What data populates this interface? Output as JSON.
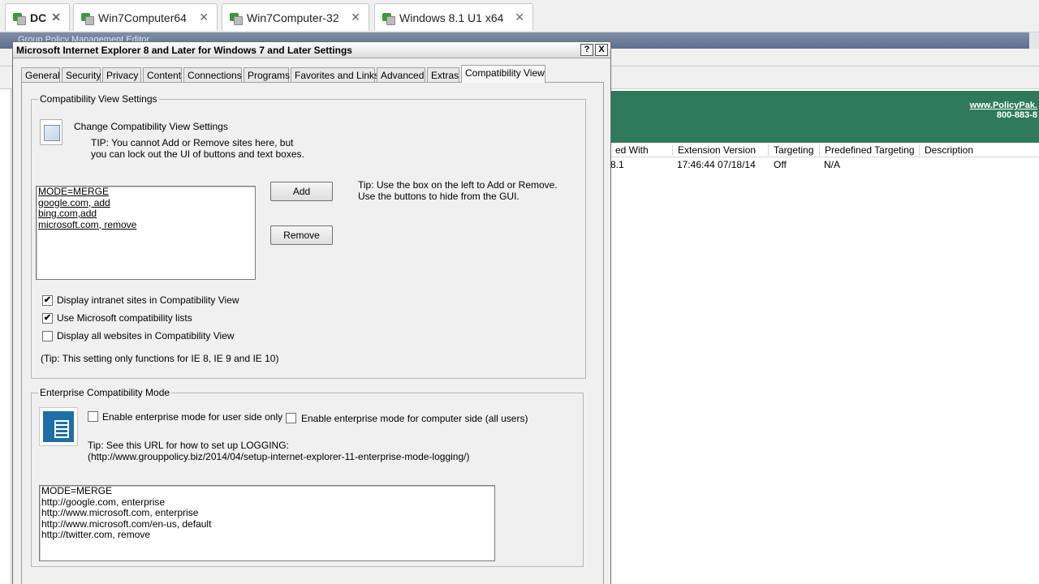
{
  "vm_tabs": [
    {
      "label": "DC",
      "active": true
    },
    {
      "label": "Win7Computer64",
      "active": false
    },
    {
      "label": "Win7Computer-32",
      "active": false
    },
    {
      "label": "Windows 8.1 U1 x64",
      "active": false
    }
  ],
  "bg_window": {
    "title": "Group Policy Management Editor",
    "banner_url": "www.PolicyPak.",
    "banner_phone": "800-883-8",
    "columns": [
      "ed With",
      "Extension Version",
      "Targeting",
      "Predefined Targeting",
      "Description"
    ],
    "row": [
      "8.1",
      "17:46:44 07/18/14",
      "Off",
      "N/A",
      ""
    ]
  },
  "dialog": {
    "title": "Microsoft Internet Explorer 8 and Later for Windows 7 and Later Settings",
    "help_btn": "?",
    "close_btn": "X",
    "tabs": [
      "General",
      "Security",
      "Privacy",
      "Content",
      "Connections",
      "Programs",
      "Favorites and Links",
      "Advanced",
      "Extras",
      "Compatibility View"
    ],
    "active_tab": "Compatibility View"
  },
  "compat": {
    "group_title": "Compatibility View Settings",
    "heading": "Change Compatibility View Settings",
    "tip1": "TIP: You cannot Add or Remove sites here, but",
    "tip2": "you can lock out the UI of buttons and text boxes.",
    "list": [
      "MODE=MERGE",
      "google.com, add",
      "bing.com,add",
      "microsoft.com, remove"
    ],
    "add_label": "Add",
    "remove_label": "Remove",
    "side_tip1": "Tip: Use the box on the left to Add or Remove.",
    "side_tip2": "Use the buttons to hide from the GUI.",
    "checkboxes": [
      {
        "label": "Display intranet sites in Compatibility View",
        "checked": "✔"
      },
      {
        "label": "Use Microsoft compatibility lists",
        "checked": "✔"
      },
      {
        "label": "Display all websites in Compatibility View",
        "checked": ""
      }
    ],
    "footnote": "(Tip: This setting only functions for IE 8, IE 9 and IE 10)"
  },
  "enterprise": {
    "group_title": "Enterprise Compatibility Mode",
    "user_label": "Enable enterprise mode for user side only",
    "computer_label": "Enable enterprise mode for computer side (all users)",
    "tip1": "Tip: See this URL for how to set up LOGGING:",
    "tip2": "(http://www.grouppolicy.biz/2014/04/setup-internet-explorer-11-enterprise-mode-logging/)",
    "list": [
      "MODE=MERGE",
      "http://google.com, enterprise",
      "http://www.microsoft.com, enterprise",
      "http://www.microsoft.com/en-us, default",
      "http://twitter.com, remove"
    ]
  }
}
